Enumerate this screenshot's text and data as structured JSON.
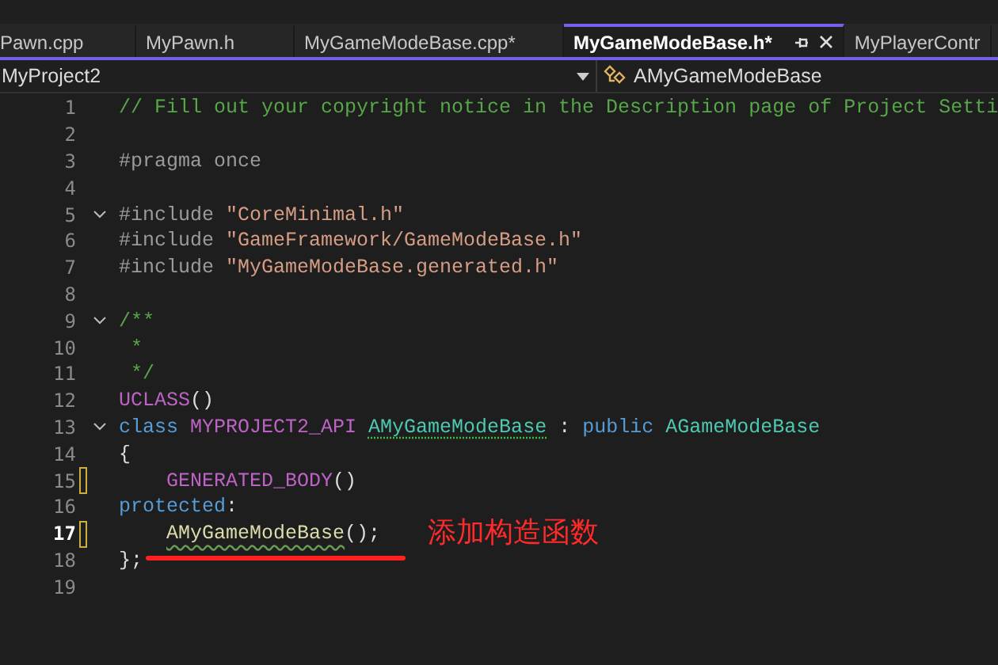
{
  "tabs": [
    {
      "label": "Pawn.cpp",
      "selected": false
    },
    {
      "label": "MyPawn.h",
      "selected": false
    },
    {
      "label": "MyGameModeBase.cpp*",
      "selected": false
    },
    {
      "label": "MyGameModeBase.h*",
      "selected": true
    },
    {
      "label": "MyPlayerContr",
      "selected": false
    }
  ],
  "navigation_bar": {
    "project": "MyProject2",
    "member": "AMyGameModeBase"
  },
  "editor": {
    "lines": [
      {
        "number": "1",
        "tokens": [
          {
            "text": "// Fill out your copyright notice in the Description page of Project Setti",
            "kind": "comment"
          }
        ]
      },
      {
        "number": "2"
      },
      {
        "number": "3",
        "tokens": [
          {
            "text": "#pragma once",
            "kind": "preproc"
          }
        ]
      },
      {
        "number": "4"
      },
      {
        "number": "5",
        "fold": true,
        "tokens": [
          {
            "text": "#include ",
            "kind": "preproc"
          },
          {
            "text": "\"CoreMinimal.h\"",
            "kind": "string"
          }
        ]
      },
      {
        "number": "6",
        "tokens": [
          {
            "text": "#include ",
            "kind": "preproc"
          },
          {
            "text": "\"GameFramework/GameModeBase.h\"",
            "kind": "string"
          }
        ]
      },
      {
        "number": "7",
        "tokens": [
          {
            "text": "#include ",
            "kind": "preproc"
          },
          {
            "text": "\"MyGameModeBase.generated.h\"",
            "kind": "string"
          }
        ]
      },
      {
        "number": "8"
      },
      {
        "number": "9",
        "fold": true,
        "tokens": [
          {
            "text": "/**",
            "kind": "comment"
          }
        ]
      },
      {
        "number": "10",
        "tokens": [
          {
            "text": " *",
            "kind": "comment"
          }
        ]
      },
      {
        "number": "11",
        "tokens": [
          {
            "text": " */",
            "kind": "comment"
          }
        ]
      },
      {
        "number": "12",
        "tokens": [
          {
            "text": "UCLASS",
            "kind": "macro"
          },
          {
            "text": "()",
            "kind": "plain"
          }
        ]
      },
      {
        "number": "13",
        "fold": true,
        "tokens": [
          {
            "text": "class ",
            "kind": "keyword"
          },
          {
            "text": "MYPROJECT2_API ",
            "kind": "macro"
          },
          {
            "text": "AMyGameModeBase",
            "kind": "type",
            "squiggle": true
          },
          {
            "text": " : ",
            "kind": "plain"
          },
          {
            "text": "public ",
            "kind": "keyword"
          },
          {
            "text": "AGameModeBase",
            "kind": "type"
          }
        ]
      },
      {
        "number": "14",
        "tokens": [
          {
            "text": "{",
            "kind": "plain"
          }
        ]
      },
      {
        "number": "15",
        "changed": true,
        "indent": true,
        "tokens": [
          {
            "text": "GENERATED_BODY",
            "kind": "macro"
          },
          {
            "text": "()",
            "kind": "plain"
          }
        ]
      },
      {
        "number": "16",
        "tokens": [
          {
            "text": "protected",
            "kind": "keyword"
          },
          {
            "text": ":",
            "kind": "plain"
          }
        ]
      },
      {
        "number": "17",
        "changed": true,
        "current": true,
        "indent": true,
        "tokens": [
          {
            "text": "AMyGameModeBase",
            "kind": "function",
            "squiggle": true
          },
          {
            "text": "();",
            "kind": "plain"
          }
        ]
      },
      {
        "number": "18",
        "tokens": [
          {
            "text": "};",
            "kind": "plain"
          }
        ]
      },
      {
        "number": "19"
      }
    ]
  },
  "annotation": {
    "text": "添加构造函数"
  }
}
